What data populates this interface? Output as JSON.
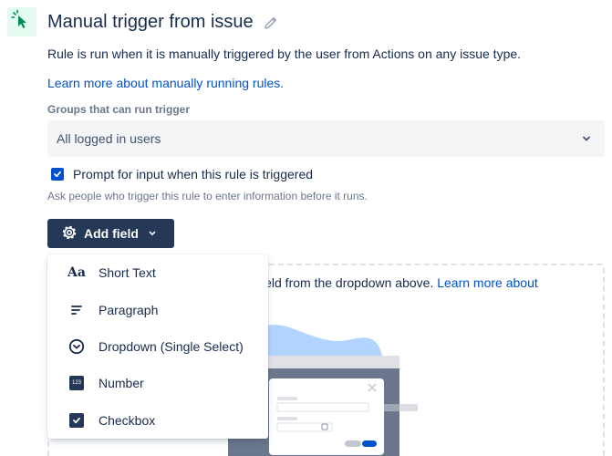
{
  "header": {
    "title": "Manual trigger from issue",
    "description": "Rule is run when it is manually triggered by the user from Actions on any issue type.",
    "learn_more": "Learn more about manually running rules."
  },
  "groups": {
    "label": "Groups that can run trigger",
    "value": "All logged in users"
  },
  "prompt": {
    "checkbox_label": "Prompt for input when this rule is triggered",
    "checked": true,
    "helper": "Ask people who trigger this rule to enter information before it runs."
  },
  "add_field": {
    "label": "Add field"
  },
  "empty_state": {
    "text": "ield from the dropdown above.",
    "link": "Learn more about"
  },
  "menu": {
    "items": [
      {
        "label": "Short Text",
        "icon": "text-format-icon"
      },
      {
        "label": "Paragraph",
        "icon": "paragraph-icon"
      },
      {
        "label": "Dropdown (Single Select)",
        "icon": "chevron-circle-icon"
      },
      {
        "label": "Number",
        "icon": "number-icon",
        "icon_text": "123"
      },
      {
        "label": "Checkbox",
        "icon": "checkbox-icon"
      }
    ]
  },
  "colors": {
    "primary": "#0052cc",
    "button_bg": "#253858",
    "trigger_icon_bg": "#e3fcef",
    "trigger_icon_fg": "#00875a"
  }
}
